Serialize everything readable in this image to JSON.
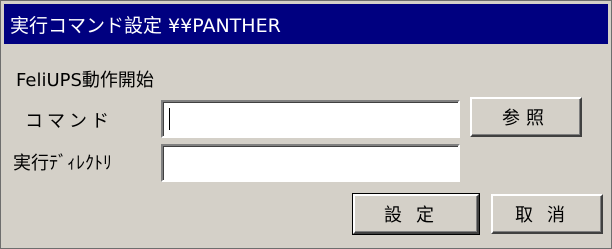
{
  "window": {
    "title": "実行コマンド設定 ¥¥PANTHER"
  },
  "section": {
    "label": "FeliUPS動作開始"
  },
  "fields": {
    "command_label": "コマンド",
    "command_value": "",
    "directory_label": "実行ﾃﾞｨﾚｸﾄﾘ",
    "directory_value": ""
  },
  "buttons": {
    "browse_label": "参照",
    "ok_label": "設定",
    "cancel_label": "取消"
  },
  "colors": {
    "titlebar": "#000080",
    "title_text": "#ffffff",
    "face": "#d4d0c8"
  }
}
